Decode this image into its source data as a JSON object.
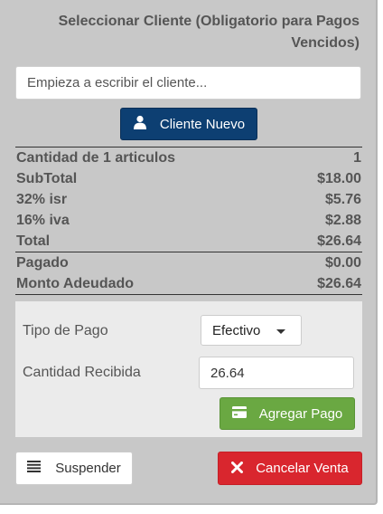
{
  "header": {
    "title_line1": "Seleccionar Cliente (Obligatorio para Pagos",
    "title_line2": "Vencidos)"
  },
  "customer": {
    "search_placeholder": "Empieza a escribir el cliente...",
    "new_customer_label": "Cliente Nuevo",
    "new_customer_icon": "user-icon"
  },
  "totals": {
    "items": [
      {
        "label": "Cantidad de 1 articulos",
        "value": "1"
      },
      {
        "label": "SubTotal",
        "value": "$18.00"
      },
      {
        "label": "32% isr",
        "value": "$5.76"
      },
      {
        "label": "16% iva",
        "value": "$2.88"
      },
      {
        "label": "Total",
        "value": "$26.64"
      },
      {
        "label": "Pagado",
        "value": "$0.00"
      },
      {
        "label": "Monto Adeudado",
        "value": "$26.64"
      }
    ]
  },
  "payment": {
    "type_label": "Tipo de Pago",
    "type_value": "Efectivo",
    "amount_label": "Cantidad Recibida",
    "amount_value": "26.64",
    "add_label": "Agregar Pago",
    "add_icon": "credit-card-icon"
  },
  "actions": {
    "suspend_label": "Suspender",
    "suspend_icon": "list-icon",
    "cancel_label": "Cancelar Venta",
    "cancel_icon": "close-icon"
  },
  "colors": {
    "primary": "#0d3f72",
    "success": "#6aa842",
    "danger": "#d9262e",
    "panel": "#c8c8c8"
  }
}
